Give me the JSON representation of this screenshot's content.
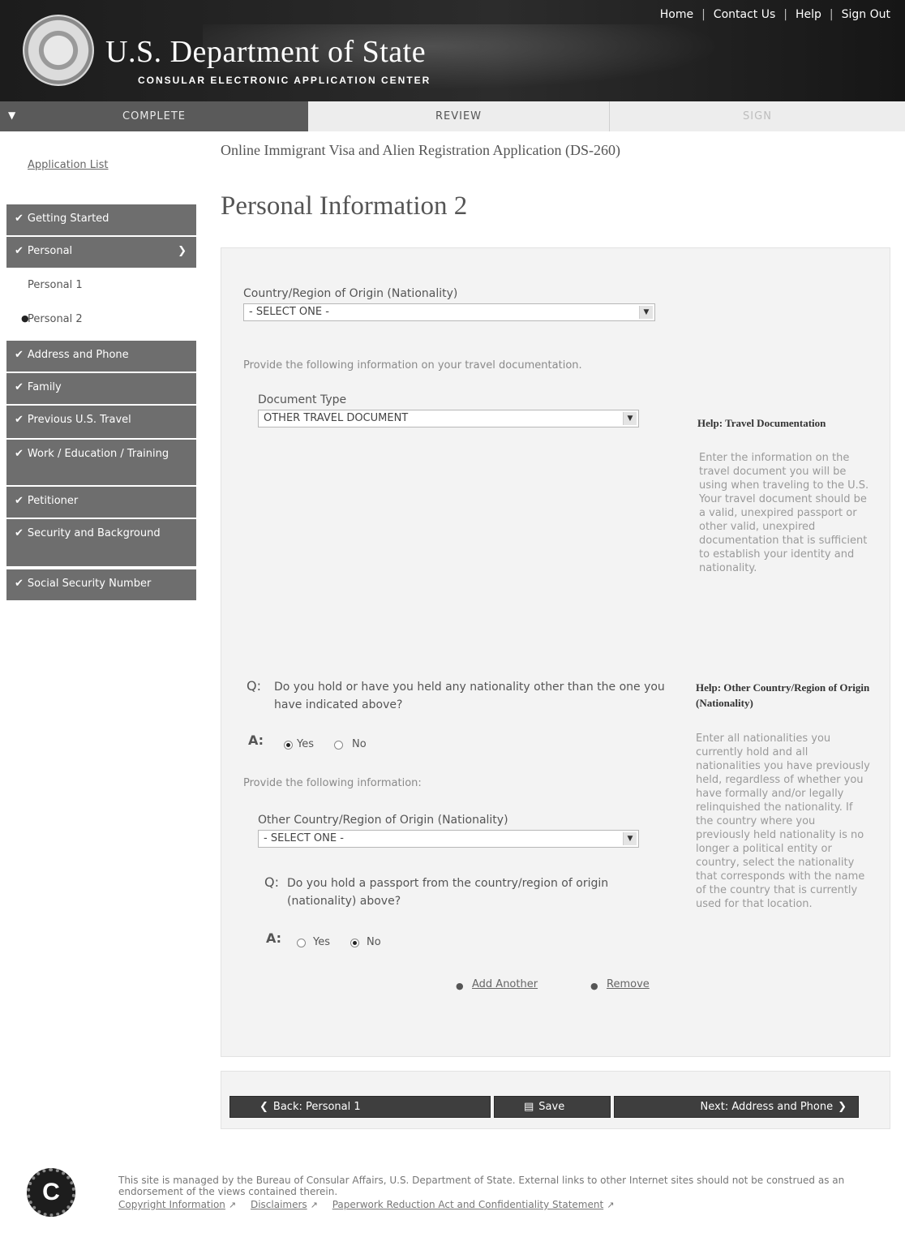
{
  "header": {
    "title": "U.S. Department of State",
    "subtitle": "CONSULAR ELECTRONIC APPLICATION CENTER",
    "nav": [
      "Home",
      "Contact Us",
      "Help",
      "Sign Out"
    ]
  },
  "progress": {
    "steps": [
      "COMPLETE",
      "REVIEW",
      "SIGN"
    ]
  },
  "sidebar": {
    "application_list": "Application List",
    "sections": [
      "Getting Started",
      "Personal",
      "Address and Phone",
      "Family",
      "Previous U.S. Travel",
      "Work / Education / Training",
      "Petitioner",
      "Security and Background",
      "Social Security Number"
    ],
    "sub_items": [
      "Personal 1",
      "Personal 2"
    ],
    "active_sub": "Personal 2"
  },
  "main": {
    "app_heading": "Online Immigrant Visa and Alien Registration Application (DS-260)",
    "page_title": "Personal Information 2",
    "nationality_label": "Country/Region of Origin (Nationality)",
    "nationality_value": "- SELECT ONE -",
    "travel_doc_instruction": "Provide the following information on your travel documentation.",
    "doc_type_label": "Document Type",
    "doc_type_value": "OTHER TRAVEL DOCUMENT",
    "q1_marker": "Q:",
    "q1_text": "Do you hold or have you held any nationality other than the one you have indicated above?",
    "a_marker": "A:",
    "yes_label": "Yes",
    "no_label": "No",
    "q1_answer": "Yes",
    "other_info_instruction": "Provide the following information:",
    "other_nationality_label": "Other Country/Region of Origin (Nationality)",
    "other_nationality_value": "- SELECT ONE -",
    "q2_text": "Do you hold a passport from the country/region of origin (nationality) above?",
    "q2_answer": "No",
    "add_another": "Add Another",
    "remove": "Remove"
  },
  "help": {
    "travel_title": "Help: Travel Documentation",
    "travel_text": "Enter the information on the travel document you will be using when traveling to the U.S. Your travel document should be a valid, unexpired passport or other valid, unexpired documentation that is sufficient to establish your identity and nationality.",
    "nationality_title": "Help: Other Country/Region of Origin (Nationality)",
    "nationality_text": "Enter all nationalities you currently hold and all nationalities you have previously held, regardless of whether you have formally and/or legally relinquished the nationality. If the country where you previously held nationality is no longer a political entity or country, select the nationality that corresponds with the name of the country that is currently used for that location."
  },
  "buttons": {
    "back": "Back: Personal 1",
    "save": "Save",
    "next": "Next: Address and Phone"
  },
  "footer": {
    "text": "This site is managed by the Bureau of Consular Affairs, U.S. Department of State. External links to other Internet sites should not be construed as an endorsement of the views contained therein.",
    "links": [
      "Copyright Information",
      "Disclaimers",
      "Paperwork Reduction Act and Confidentiality Statement"
    ]
  }
}
